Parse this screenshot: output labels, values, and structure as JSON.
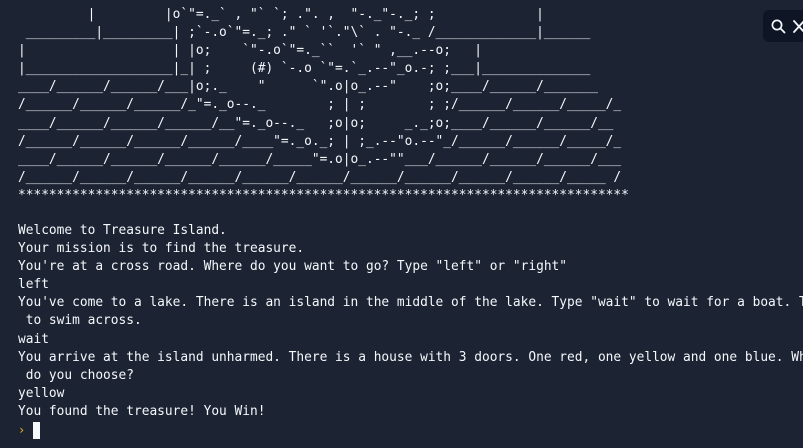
{
  "console": {
    "ascii_art": "         |         |o`\"=._` , \"` `; .\". ,  \"-._\"-._; ;             |\n _________|_________| ;`-.o`\"=._; .\" ` '`.\"\\` . \"-._ /_____________|______\n|                   | |o;    `\"-.o`\"=._``  '` \" ,__.--o;   |\n|___________________|_| ;     (#) `-.o `\"=.`_.--\"_o.-; ;___|______________\n____/______/______/___|o;._    \"      `\".o|o_.--\"    ;o;____/______/_______\n/______/______/______/_\"=._o--._        ; | ;        ; ;/______/______/_____/_\n____/______/______/______/__\"=._o--._   ;o|o;     _._;o;____/______/______/__\n/______/______/______/______/____\"=._o._; | ;_.--\"o.--\"_/______/______/_____/_\n____/______/______/______/______/_____\"=.o|o_.--\"\"___/______/______/______/___\n/______/______/______/______/______/______/______/______/______/______/_____ /\n*******************************************************************************",
    "lines": [
      "Welcome to Treasure Island.",
      "Your mission is to find the treasure.",
      "You're at a cross road. Where do you want to go? Type \"left\" or \"right\"",
      "left",
      "You've come to a lake. There is an island in the middle of the lake. Type \"wait\" to wait for a boat. Type \"swim\"",
      " to swim across.",
      "wait",
      "You arrive at the island unharmed. There is a house with 3 doors. One red, one yellow and one blue. Which colour",
      " do you choose?",
      "yellow",
      "You found the treasure! You Win!"
    ],
    "prompt_symbol": "›"
  },
  "search": {
    "icon": "search-icon",
    "second_icon": "close-icon"
  },
  "colors": {
    "background": "#1c2333",
    "text": "#f5f9fc",
    "prompt": "#f0b429",
    "search_bg": "#0e1525"
  }
}
